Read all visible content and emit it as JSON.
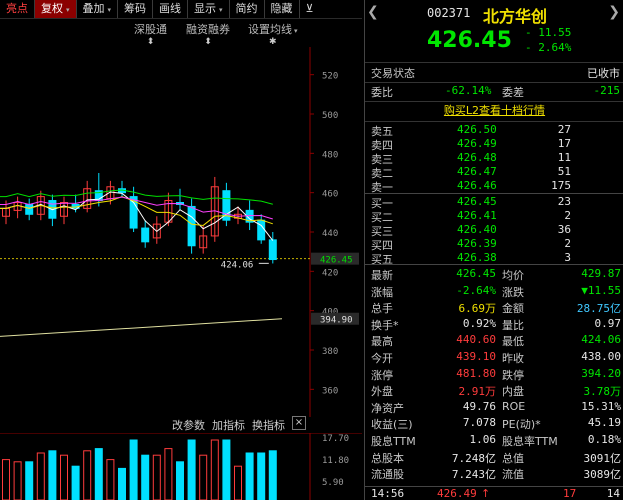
{
  "toolbar": {
    "items": [
      {
        "label": "亮点",
        "dd": false,
        "state": "normal"
      },
      {
        "label": "复权",
        "dd": true,
        "state": "active"
      },
      {
        "label": "叠加",
        "dd": true,
        "state": "normal"
      },
      {
        "label": "筹码",
        "dd": false,
        "state": "normal"
      },
      {
        "label": "画线",
        "dd": false,
        "state": "normal"
      },
      {
        "label": "显示",
        "dd": true,
        "state": "normal"
      },
      {
        "label": "简约",
        "dd": false,
        "state": "normal"
      },
      {
        "label": "隐藏",
        "dd": false,
        "state": "normal"
      }
    ]
  },
  "subbar": {
    "shen_gu_tong": "深股通",
    "rong_zi_rong_quan": "融资融券",
    "set_ma": "设置均线"
  },
  "price_axis": {
    "ticks": [
      520,
      500,
      480,
      460,
      440,
      420,
      400,
      380,
      360
    ],
    "current_price_tag": "426.45",
    "ma_tag": "394.90",
    "low_annotation": "424.06"
  },
  "bottom_bar": {
    "left": "改参数",
    "mid": "加指标",
    "right": "换指标",
    "close": "×"
  },
  "volume_axis": {
    "labels": [
      "17.70",
      "11.80",
      "5.90"
    ]
  },
  "colors": {
    "up": "#ff3c3c",
    "down": "#00e0ff",
    "ma5": "#ffffff",
    "ma10": "#f0e000",
    "ma20": "#ff40ff",
    "ma60": "#00e000",
    "ma_long": "#e0e0a0"
  },
  "chart_data": {
    "type": "candlestick",
    "ylim": [
      350,
      530
    ],
    "candles": [
      {
        "o": 448,
        "c": 452,
        "h": 456,
        "l": 444
      },
      {
        "o": 451,
        "c": 455,
        "h": 458,
        "l": 447
      },
      {
        "o": 454,
        "c": 449,
        "h": 457,
        "l": 446
      },
      {
        "o": 449,
        "c": 458,
        "h": 461,
        "l": 446
      },
      {
        "o": 456,
        "c": 447,
        "h": 459,
        "l": 443
      },
      {
        "o": 448,
        "c": 455,
        "h": 458,
        "l": 444
      },
      {
        "o": 454,
        "c": 452,
        "h": 459,
        "l": 450
      },
      {
        "o": 452,
        "c": 462,
        "h": 466,
        "l": 450
      },
      {
        "o": 461,
        "c": 456,
        "h": 470,
        "l": 453
      },
      {
        "o": 457,
        "c": 463,
        "h": 466,
        "l": 454
      },
      {
        "o": 462,
        "c": 460,
        "h": 466,
        "l": 458
      },
      {
        "o": 458,
        "c": 442,
        "h": 463,
        "l": 440
      },
      {
        "o": 442,
        "c": 435,
        "h": 446,
        "l": 432
      },
      {
        "o": 437,
        "c": 444,
        "h": 448,
        "l": 434
      },
      {
        "o": 445,
        "c": 456,
        "h": 460,
        "l": 443
      },
      {
        "o": 455,
        "c": 454,
        "h": 462,
        "l": 451
      },
      {
        "o": 453,
        "c": 433,
        "h": 457,
        "l": 429
      },
      {
        "o": 432,
        "c": 438,
        "h": 443,
        "l": 429
      },
      {
        "o": 438,
        "c": 463,
        "h": 468,
        "l": 435
      },
      {
        "o": 461,
        "c": 446,
        "h": 465,
        "l": 443
      },
      {
        "o": 447,
        "c": 449,
        "h": 453,
        "l": 444
      },
      {
        "o": 451,
        "c": 445,
        "h": 456,
        "l": 441
      },
      {
        "o": 446,
        "c": 436,
        "h": 449,
        "l": 434
      },
      {
        "o": 436,
        "c": 426,
        "h": 440,
        "l": 424
      }
    ]
  },
  "quote": {
    "code": "002371",
    "name": "北方华创",
    "price": "426.45",
    "change": "- 11.55",
    "pct": "- 2.64%",
    "trade_status_label": "交易状态",
    "trade_status": "已收市",
    "weibi_label": "委比",
    "weibi": "-62.14%",
    "weicha_label": "委差",
    "weicha": "-215",
    "l2_link": "购买L2查看十档行情",
    "asks": [
      {
        "label": "卖五",
        "price": "426.50",
        "vol": "27"
      },
      {
        "label": "卖四",
        "price": "426.49",
        "vol": "17"
      },
      {
        "label": "卖三",
        "price": "426.48",
        "vol": "11"
      },
      {
        "label": "卖二",
        "price": "426.47",
        "vol": "51"
      },
      {
        "label": "卖一",
        "price": "426.46",
        "vol": "175"
      }
    ],
    "bids": [
      {
        "label": "买一",
        "price": "426.45",
        "vol": "23"
      },
      {
        "label": "买二",
        "price": "426.41",
        "vol": "2"
      },
      {
        "label": "买三",
        "price": "426.40",
        "vol": "36"
      },
      {
        "label": "买四",
        "price": "426.39",
        "vol": "2"
      },
      {
        "label": "买五",
        "price": "426.38",
        "vol": "3"
      }
    ],
    "stats": [
      {
        "l1": "最新",
        "v1": "426.45",
        "c1": "green",
        "l2": "均价",
        "v2": "429.87",
        "c2": "green"
      },
      {
        "l1": "涨幅",
        "v1": "-2.64%",
        "c1": "green",
        "l2": "涨跌",
        "v2": "▼11.55",
        "c2": "green"
      },
      {
        "l1": "总手",
        "v1": "6.69万",
        "c1": "yellow",
        "l2": "金额",
        "v2": "28.75亿",
        "c2": "cyan"
      },
      {
        "l1": "换手*",
        "v1": "0.92%",
        "c1": "white",
        "l2": "量比",
        "v2": "0.97",
        "c2": "white"
      },
      {
        "l1": "最高",
        "v1": "440.60",
        "c1": "red",
        "l2": "最低",
        "v2": "424.06",
        "c2": "green"
      },
      {
        "l1": "今开",
        "v1": "439.10",
        "c1": "red",
        "l2": "昨收",
        "v2": "438.00",
        "c2": "white"
      },
      {
        "l1": "涨停",
        "v1": "481.80",
        "c1": "red",
        "l2": "跌停",
        "v2": "394.20",
        "c2": "green"
      },
      {
        "l1": "外盘",
        "v1": "2.91万",
        "c1": "red",
        "l2": "内盘",
        "v2": "3.78万",
        "c2": "green"
      },
      {
        "l1": "净资产",
        "v1": "49.76",
        "c1": "white",
        "l2": "ROE",
        "v2": "15.31%",
        "c2": "white"
      },
      {
        "l1": "收益(三)",
        "v1": "7.078",
        "c1": "white",
        "l2": "PE(动)*",
        "v2": "45.19",
        "c2": "white"
      },
      {
        "l1": "股息TTM",
        "v1": "1.06",
        "c1": "white",
        "l2": "股息率TTM",
        "v2": "0.18%",
        "c2": "white"
      },
      {
        "l1": "总股本",
        "v1": "7.248亿",
        "c1": "white",
        "l2": "总值",
        "v2": "3091亿",
        "c2": "white"
      },
      {
        "l1": "流通股",
        "v1": "7.243亿",
        "c1": "white",
        "l2": "流值",
        "v2": "3089亿",
        "c2": "white"
      }
    ],
    "tick": {
      "time": "14:56",
      "price": "426.49",
      "arrow": "↑",
      "vol": "17",
      "n": "14"
    }
  }
}
